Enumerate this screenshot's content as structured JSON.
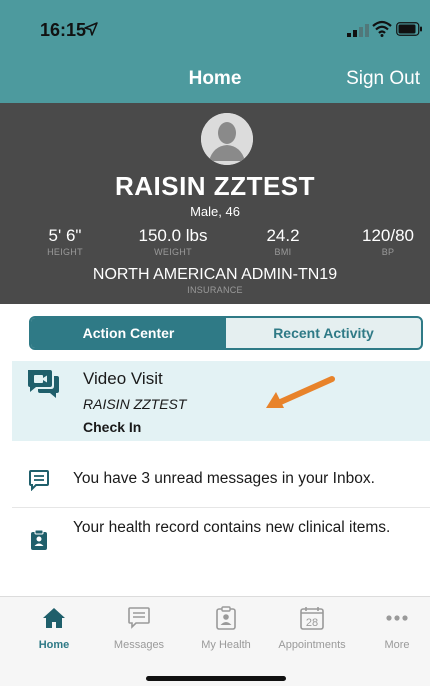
{
  "status_bar": {
    "time": "16:15"
  },
  "nav": {
    "title": "Home",
    "sign_out": "Sign Out"
  },
  "profile": {
    "name": "RAISIN ZZTEST",
    "demographics": "Male, 46",
    "stats": [
      {
        "value": "5' 6\"",
        "label": "HEIGHT"
      },
      {
        "value": "150.0 lbs",
        "label": "WEIGHT"
      },
      {
        "value": "24.2",
        "label": "BMI"
      },
      {
        "value": "120/80",
        "label": "BP"
      }
    ],
    "insurance": {
      "value": "NORTH AMERICAN ADMIN-TN19",
      "label": "INSURANCE"
    }
  },
  "segmented": {
    "tabs": [
      "Action Center",
      "Recent Activity"
    ],
    "selected": "Action Center"
  },
  "visit": {
    "title": "Video Visit",
    "patient": "RAISIN ZZTEST",
    "action": "Check In"
  },
  "list": [
    {
      "icon": "message-icon",
      "text": "You have 3 unread messages in your Inbox."
    },
    {
      "icon": "clipboard-icon",
      "text": "Your health record contains new clinical items."
    }
  ],
  "tabbar": [
    {
      "icon": "home-icon",
      "label": "Home",
      "active": true
    },
    {
      "icon": "messages-icon",
      "label": "Messages"
    },
    {
      "icon": "my-health-icon",
      "label": "My Health"
    },
    {
      "icon": "calendar-icon",
      "label": "Appointments",
      "icon_text": "28"
    },
    {
      "icon": "more-icon",
      "label": "More"
    }
  ],
  "colors": {
    "teal": "#4d9a9e",
    "accent": "#2f7a86",
    "header_bg": "#4a4a4a",
    "arrow": "#e8832a"
  }
}
